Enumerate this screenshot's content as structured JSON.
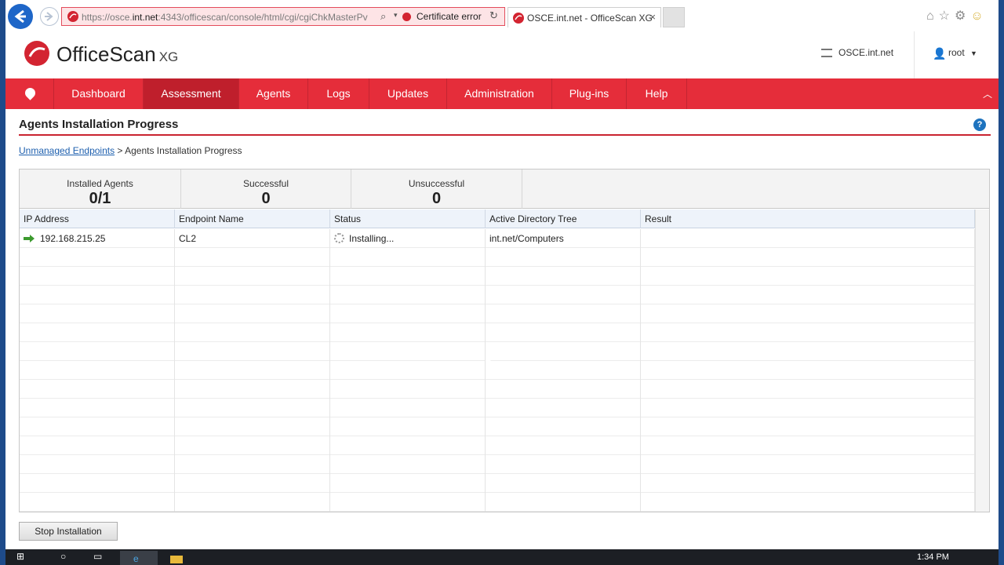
{
  "browser": {
    "url_prefix": "https://osce.",
    "url_host": "int.net",
    "url_rest": ":4343/officescan/console/html/cgi/cgiChkMasterPv",
    "cert_error": "Certificate error",
    "tab_title": "OSCE.int.net - OfficeScan XG"
  },
  "header": {
    "product": "OfficeScan",
    "product_suffix": "XG",
    "server": "OSCE.int.net",
    "user": "root"
  },
  "nav": {
    "items": [
      "Dashboard",
      "Assessment",
      "Agents",
      "Logs",
      "Updates",
      "Administration",
      "Plug-ins",
      "Help"
    ],
    "active": "Assessment"
  },
  "page": {
    "title": "Agents Installation Progress",
    "breadcrumb_link": "Unmanaged Endpoints",
    "breadcrumb_sep": " > ",
    "breadcrumb_current": "Agents Installation Progress"
  },
  "summary": {
    "installed_label": "Installed Agents",
    "installed_value": "0/1",
    "successful_label": "Successful",
    "successful_value": "0",
    "unsuccessful_label": "Unsuccessful",
    "unsuccessful_value": "0"
  },
  "table": {
    "columns": [
      "IP Address",
      "Endpoint Name",
      "Status",
      "Active Directory Tree",
      "Result"
    ],
    "rows": [
      {
        "ip": "192.168.215.25",
        "endpoint": "CL2",
        "status": "Installing...",
        "ad_tree": "int.net/Computers",
        "result": ""
      }
    ]
  },
  "actions": {
    "stop_label": "Stop Installation"
  },
  "taskbar": {
    "time": "1:34 PM"
  },
  "colors": {
    "brand_red": "#e52d3a",
    "nav_active": "#bf1f2c",
    "link_blue": "#1d5fae",
    "success_green": "#3c9a2e"
  }
}
